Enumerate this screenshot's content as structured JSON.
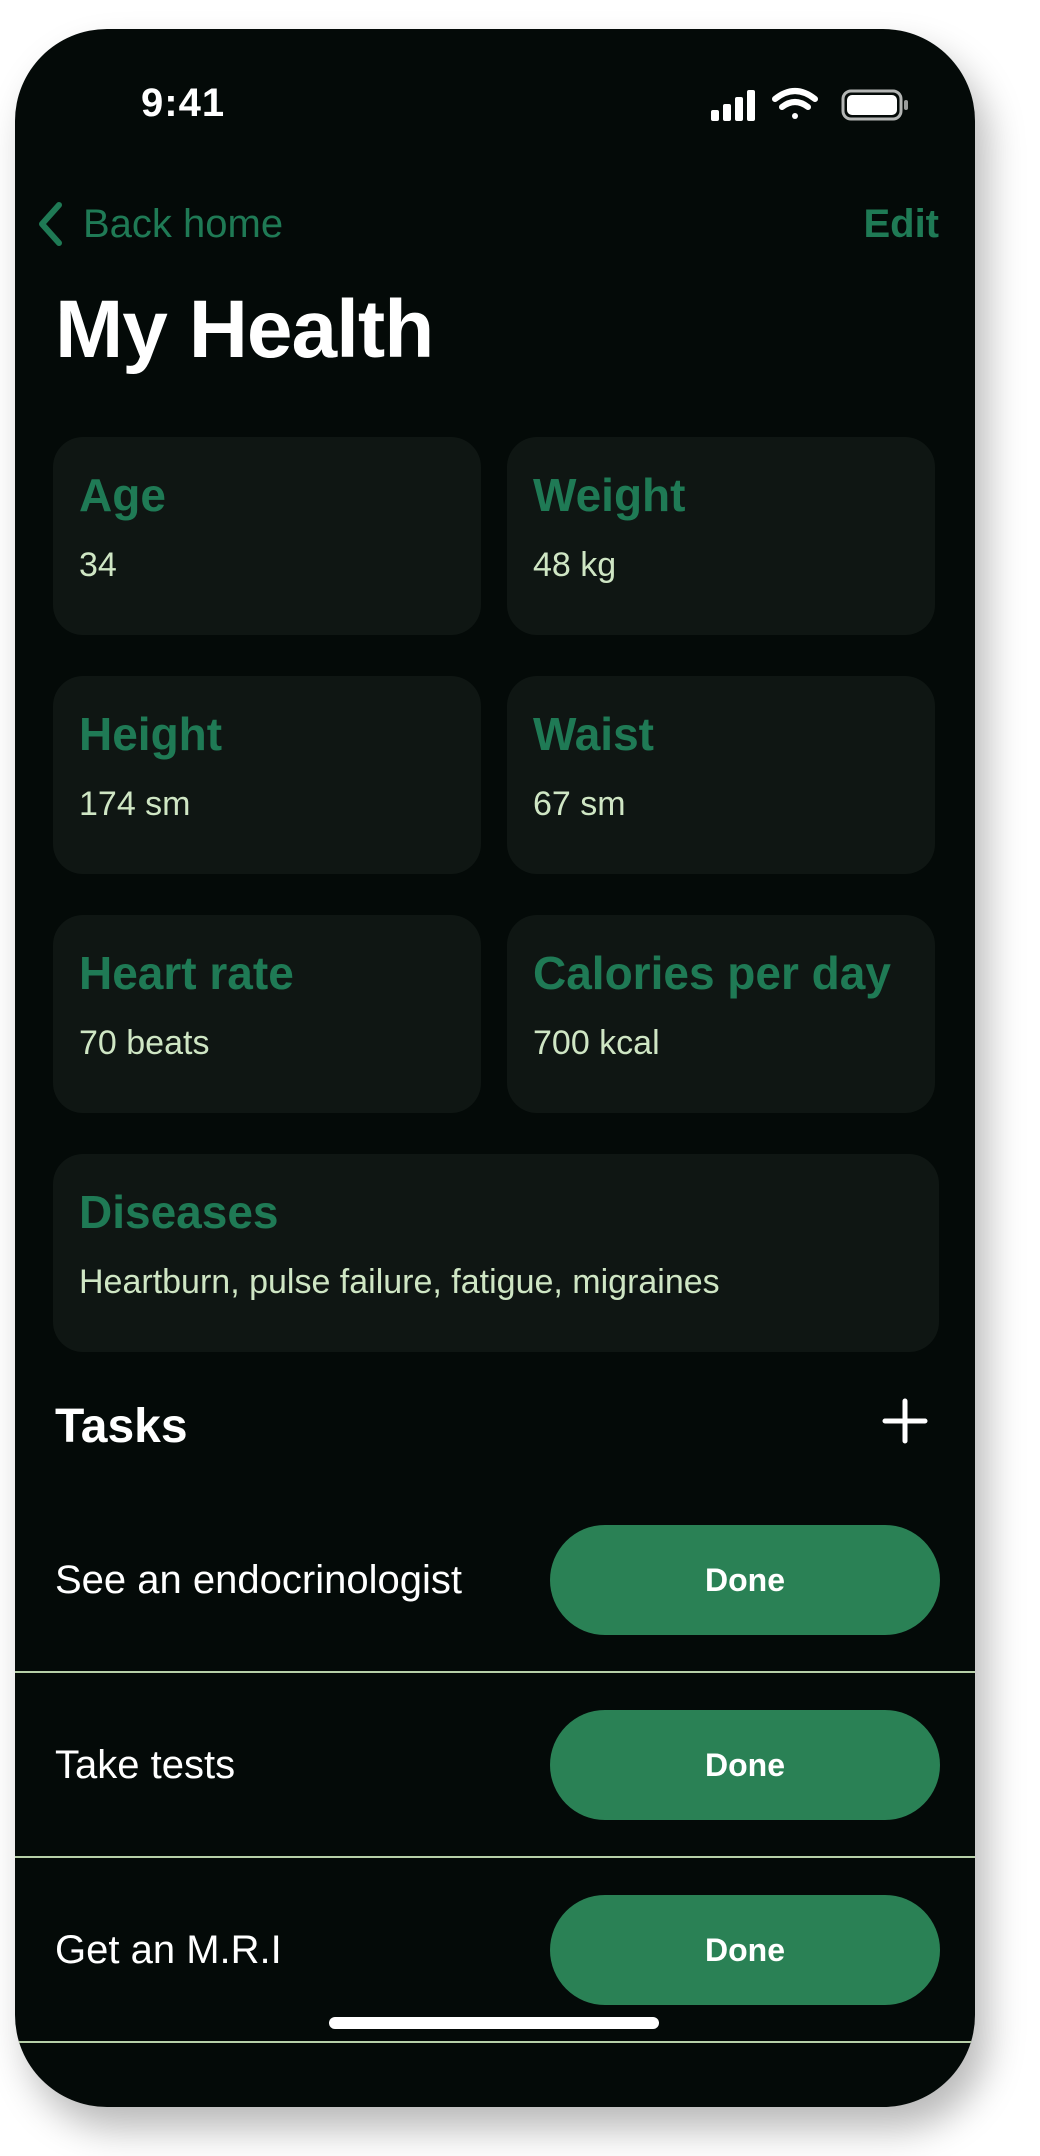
{
  "status_bar": {
    "time": "9:41",
    "icons": [
      "cellular-signal-icon",
      "wifi-icon",
      "battery-icon"
    ]
  },
  "nav": {
    "back_label": "Back home",
    "back_icon": "chevron-left-icon",
    "edit_label": "Edit"
  },
  "title": "My Health",
  "colors": {
    "background": "#040a08",
    "accent": "#1f7a55",
    "button": "#2a8155",
    "card": "#0f1613",
    "value_text": "#cfe6c4"
  },
  "metrics": [
    {
      "label": "Age",
      "value": "34"
    },
    {
      "label": "Weight",
      "value": "48 kg"
    },
    {
      "label": "Height",
      "value": "174 sm"
    },
    {
      "label": "Waist",
      "value": "67 sm"
    },
    {
      "label": "Heart rate",
      "value": "70 beats"
    },
    {
      "label": "Calories per day",
      "value": "700 kcal"
    }
  ],
  "diseases": {
    "label": "Diseases",
    "value": "Heartburn, pulse failure, fatigue, migraines"
  },
  "tasks": {
    "header": "Tasks",
    "add_icon": "plus-icon",
    "items": [
      {
        "label": "See an endocrinologist",
        "button": "Done"
      },
      {
        "label": "Take tests",
        "button": "Done"
      },
      {
        "label": "Get an M.R.I",
        "button": "Done"
      }
    ]
  }
}
